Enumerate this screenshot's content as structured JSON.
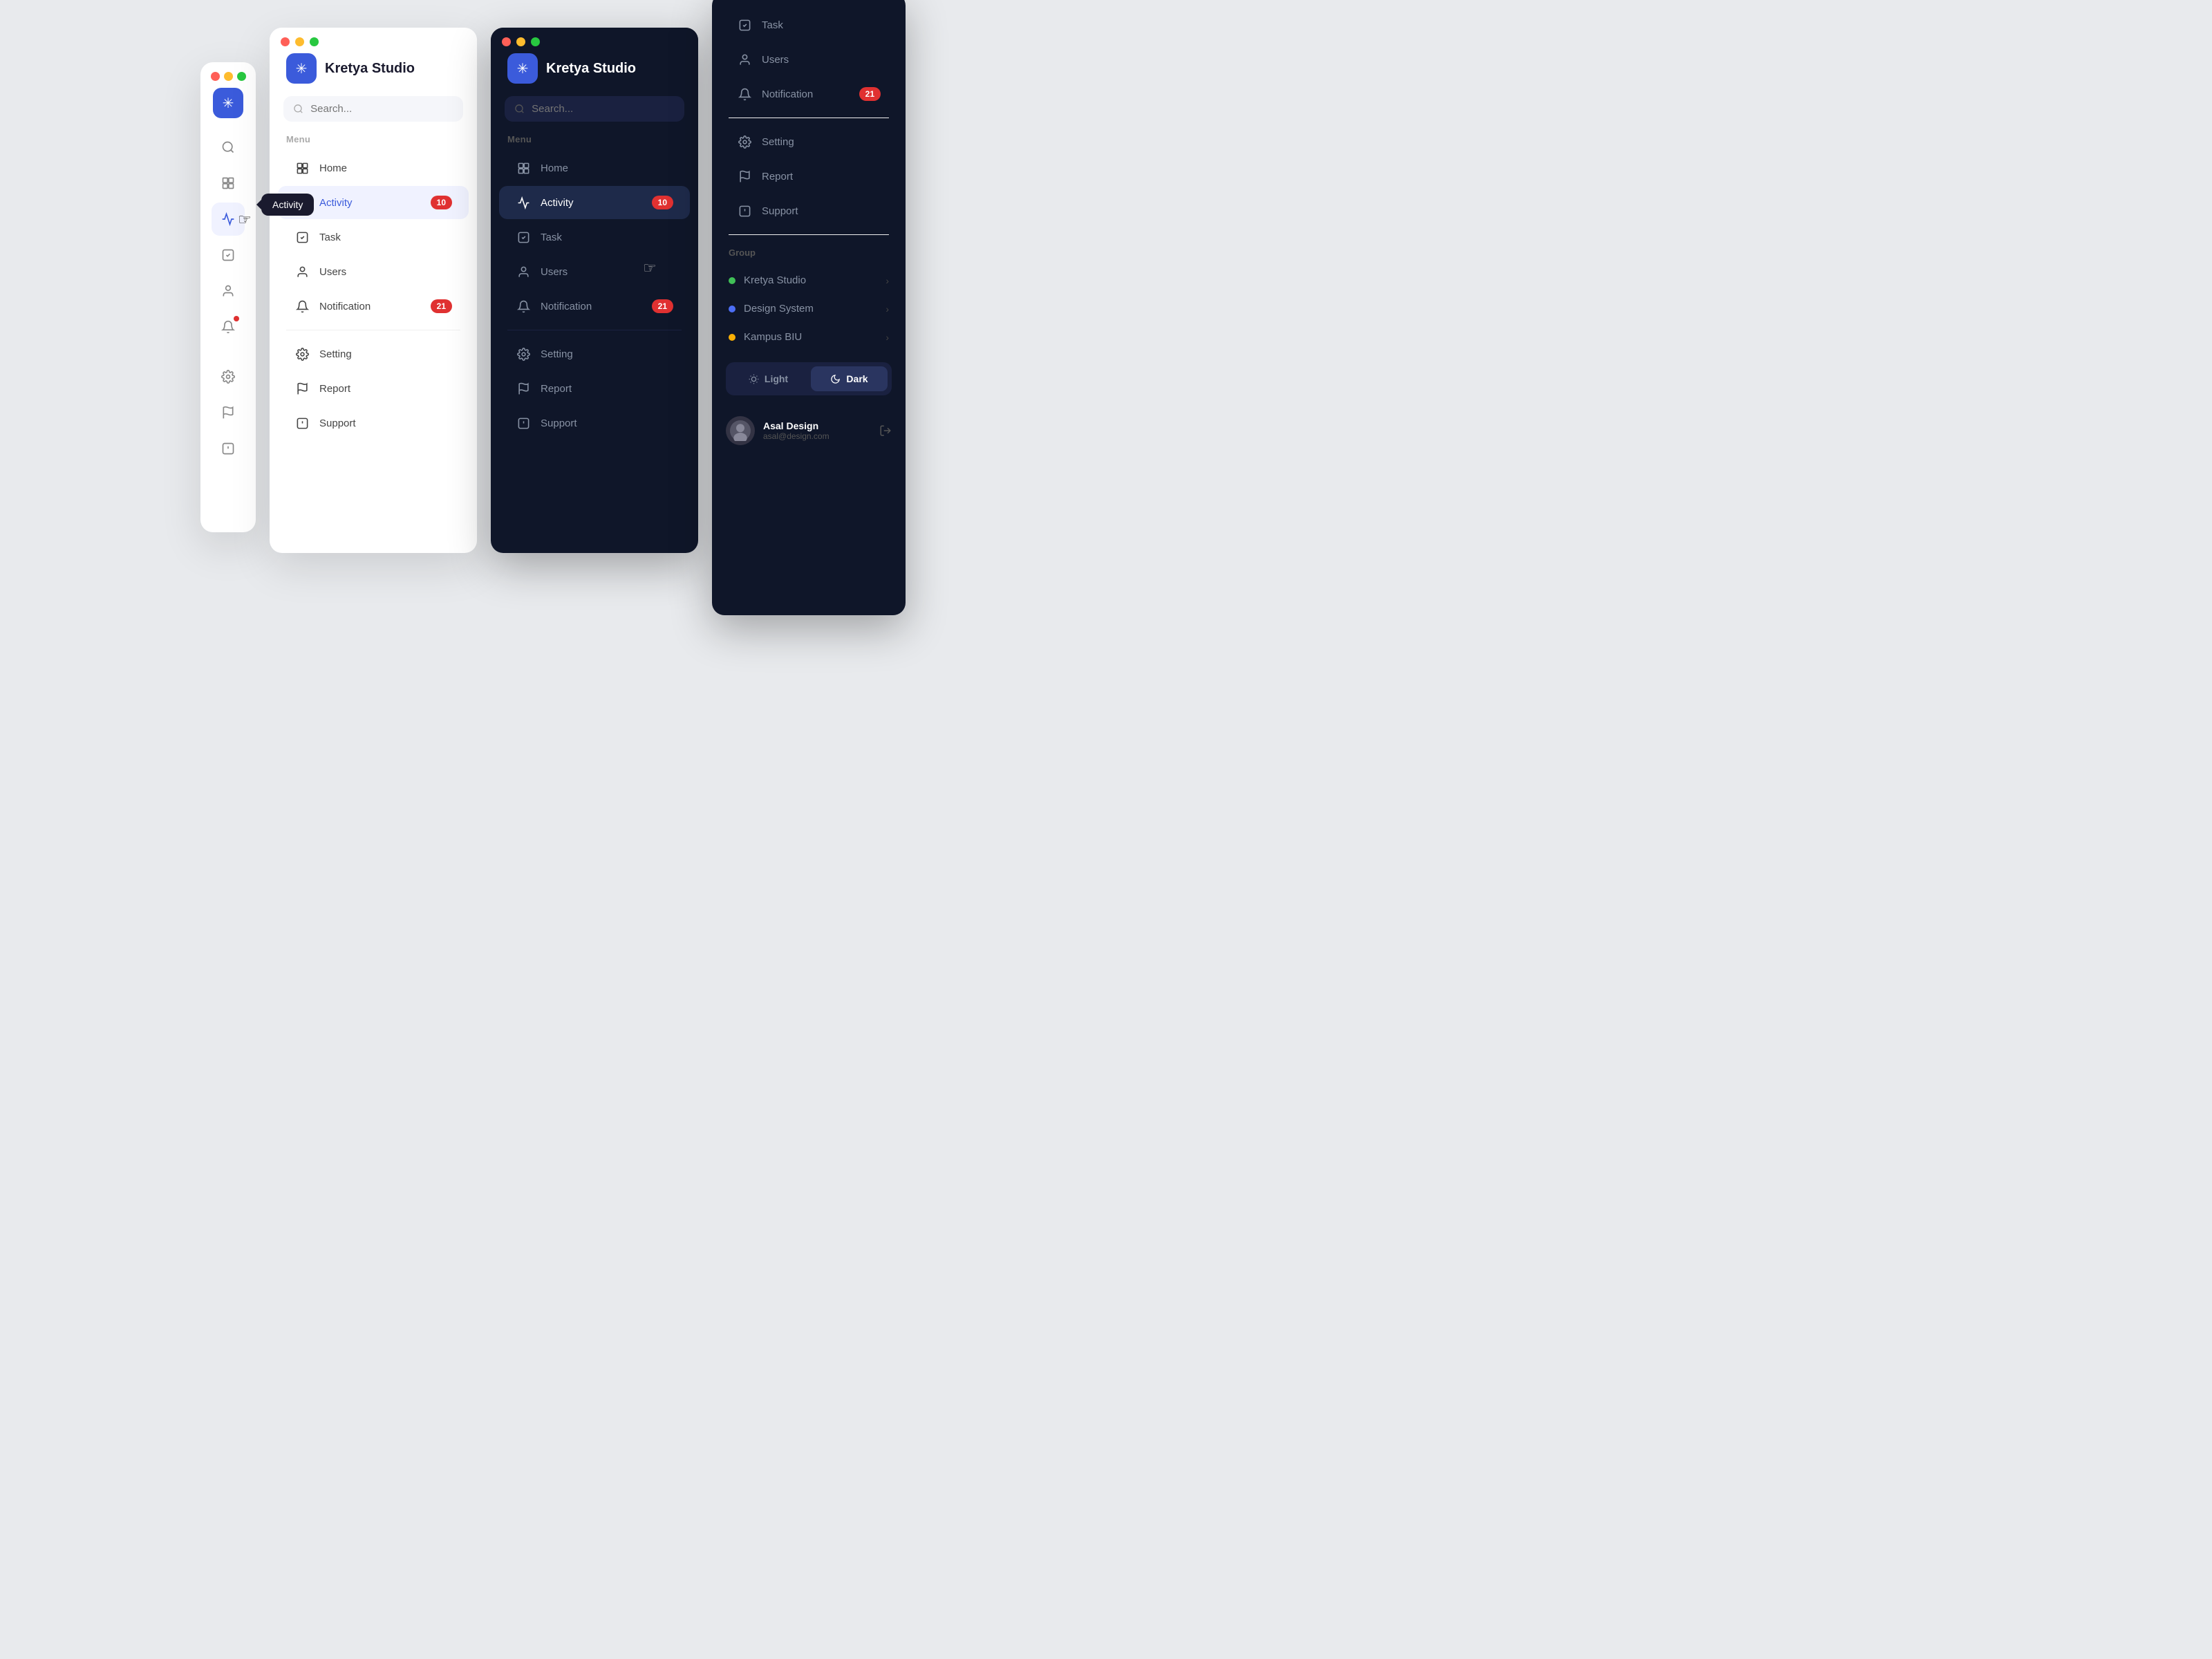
{
  "app": {
    "name": "Kretya Studio",
    "icon": "✳"
  },
  "tooltip": {
    "label": "Activity"
  },
  "search": {
    "placeholder": "Search..."
  },
  "menu_label": "Menu",
  "group_label": "Group",
  "nav_items": [
    {
      "id": "home",
      "label": "Home",
      "icon": "home",
      "badge": null
    },
    {
      "id": "activity",
      "label": "Activity",
      "icon": "activity",
      "badge": "10"
    },
    {
      "id": "task",
      "label": "Task",
      "icon": "task",
      "badge": null
    },
    {
      "id": "users",
      "label": "Users",
      "icon": "users",
      "badge": null
    },
    {
      "id": "notification",
      "label": "Notification",
      "icon": "bell",
      "badge": "21"
    }
  ],
  "bottom_nav": [
    {
      "id": "setting",
      "label": "Setting",
      "icon": "setting",
      "badge": null
    },
    {
      "id": "report",
      "label": "Report",
      "icon": "report",
      "badge": null
    },
    {
      "id": "support",
      "label": "Support",
      "icon": "support",
      "badge": null
    }
  ],
  "right_panel_top": [
    {
      "id": "task",
      "label": "Task",
      "icon": "task"
    },
    {
      "id": "users",
      "label": "Users",
      "icon": "users"
    },
    {
      "id": "notification",
      "label": "Notification",
      "icon": "bell",
      "badge": "21"
    },
    {
      "id": "setting",
      "label": "Setting",
      "icon": "setting"
    },
    {
      "id": "report",
      "label": "Report",
      "icon": "report"
    },
    {
      "id": "support",
      "label": "Support",
      "icon": "support"
    }
  ],
  "groups": [
    {
      "id": "kretya",
      "label": "Kretya Studio",
      "color": "#40c057"
    },
    {
      "id": "design",
      "label": "Design System",
      "color": "#4c6ef5"
    },
    {
      "id": "kampus",
      "label": "Kampus BIU",
      "color": "#fab005"
    }
  ],
  "theme": {
    "light_label": "Light",
    "dark_label": "Dark"
  },
  "user": {
    "name": "Asal Design",
    "email": "asal@design.com"
  },
  "colors": {
    "accent": "#3b5bdb",
    "danger": "#e03131",
    "dark_bg": "#0f1629",
    "dark_card": "#1a2140",
    "active_dark": "#1e2a4a"
  }
}
